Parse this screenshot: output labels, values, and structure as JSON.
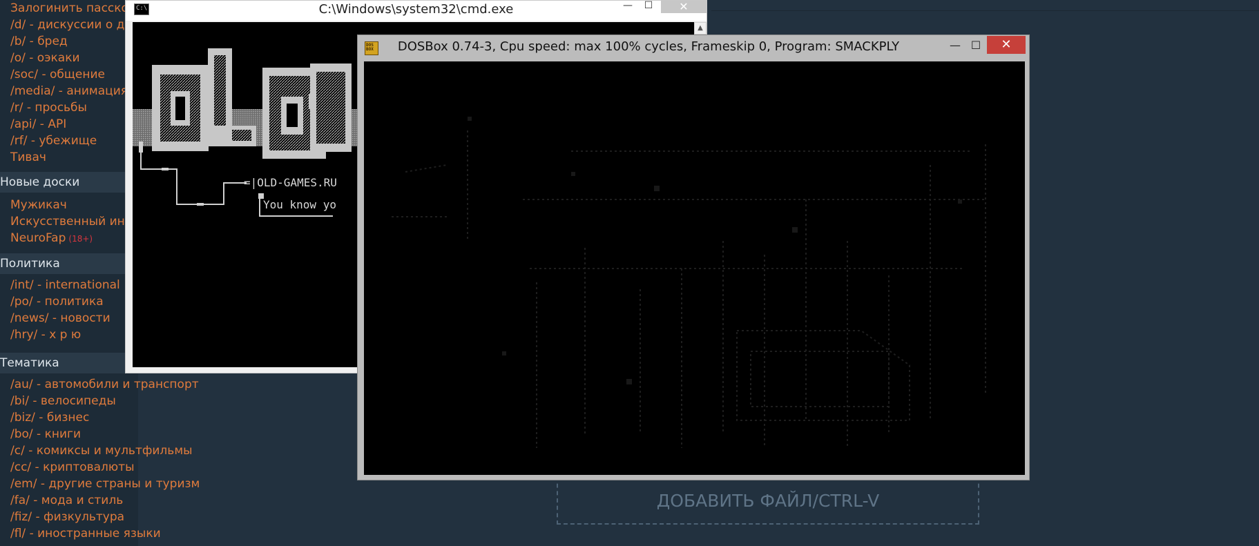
{
  "sidebar": {
    "top_items": [
      {
        "label": "Залогинить пасскод"
      },
      {
        "label": "/d/ - дискуссии о двач"
      },
      {
        "label": "/b/ - бред"
      },
      {
        "label": "/o/ - оэкаки"
      },
      {
        "label": "/soc/ - общение"
      },
      {
        "label": "/media/ - анимация"
      },
      {
        "label": "/r/ - просьбы"
      },
      {
        "label": "/api/ - API"
      },
      {
        "label": "/rf/ - убежище"
      },
      {
        "label": "Тивач"
      }
    ],
    "new_boards": {
      "heading": "Новые доски",
      "items": [
        {
          "label": "Мужикач"
        },
        {
          "label": "Искусственный интеллект"
        },
        {
          "label": "NeuroFap",
          "tag": "(18+)"
        }
      ]
    },
    "politics": {
      "heading": "Политика",
      "items": [
        {
          "label": "/int/ - international"
        },
        {
          "label": "/po/ - политика"
        },
        {
          "label": "/news/ - новости"
        },
        {
          "label": "/hry/ - х р ю"
        }
      ]
    },
    "thematic": {
      "heading": "Тематика",
      "items": [
        {
          "label": "/au/ - автомобили и транспорт"
        },
        {
          "label": "/bi/ - велосипеды"
        },
        {
          "label": "/biz/ - бизнес"
        },
        {
          "label": "/bo/ - книги"
        },
        {
          "label": "/c/ - комиксы и мультфильмы"
        },
        {
          "label": "/cc/ - криптовалюты"
        },
        {
          "label": "/em/ - другие страны и туризм"
        },
        {
          "label": "/fa/ - мода и стиль"
        },
        {
          "label": "/fiz/ - физкультура"
        },
        {
          "label": "/fl/ - иностранные языки"
        }
      ]
    }
  },
  "add_file_label": "ДОБАВИТЬ ФАЙЛ/CTRL-V",
  "cmd": {
    "title": "C:\\Windows\\system32\\cmd.exe",
    "icon_text": "C:\\",
    "minimize": "—",
    "maximize": "☐",
    "close": "✕",
    "scroll_up": "▲",
    "terminal_lines": {
      "site": "=|OLD-GAMES.RU",
      "tagline": "You know yo"
    },
    "logo_letters": [
      "o",
      "L",
      "d",
      "G"
    ]
  },
  "dosbox": {
    "title": "DOSBox 0.74-3, Cpu speed: max 100% cycles, Frameskip  0, Program: SMACKPLY",
    "icon_text": "DOS BOX",
    "minimize": "—",
    "maximize": "☐",
    "close": "✕"
  },
  "colors": {
    "page_bg": "#22313f",
    "sidebar_bg": "#1d2b37",
    "link": "#e07b3c",
    "dosbox_close": "#c6403a"
  }
}
